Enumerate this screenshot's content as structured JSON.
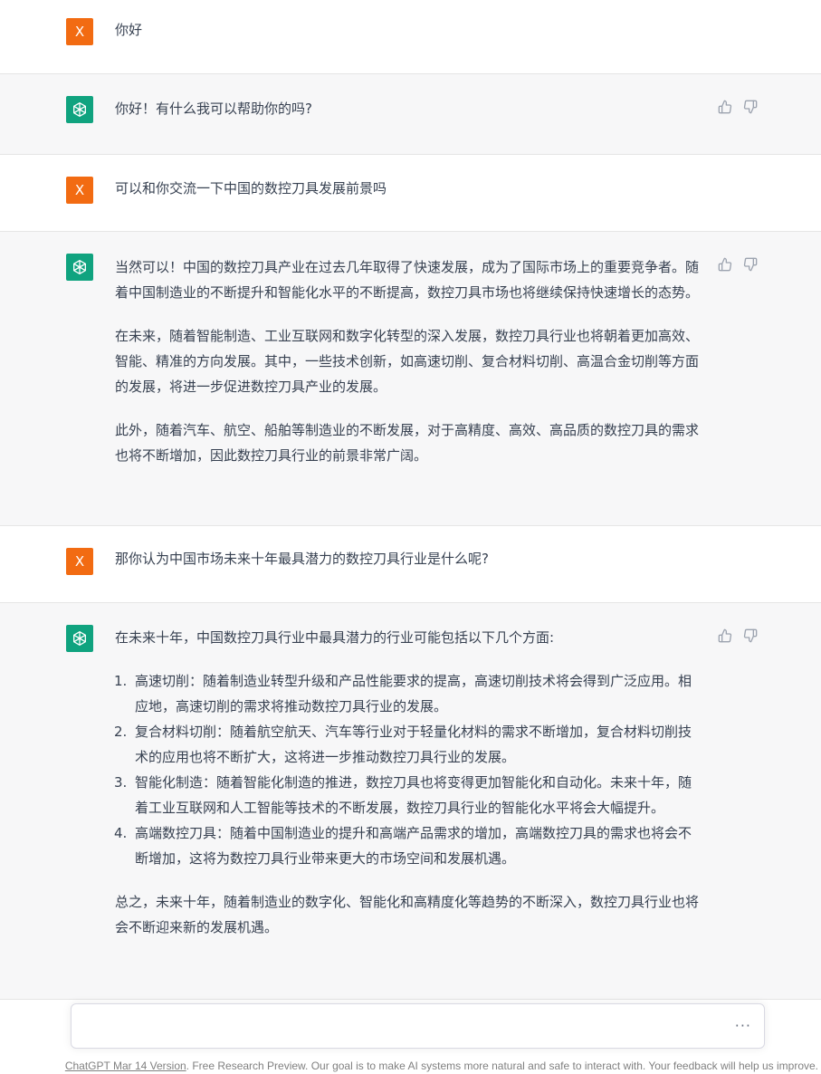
{
  "messages": [
    {
      "role": "user",
      "avatar_letter": "X",
      "text": "你好"
    },
    {
      "role": "assistant",
      "paragraphs": [
        "你好！有什么我可以帮助你的吗?"
      ]
    },
    {
      "role": "user",
      "avatar_letter": "X",
      "text": "可以和你交流一下中国的数控刀具发展前景吗"
    },
    {
      "role": "assistant",
      "paragraphs": [
        "当然可以！中国的数控刀具产业在过去几年取得了快速发展，成为了国际市场上的重要竞争者。随着中国制造业的不断提升和智能化水平的不断提高，数控刀具市场也将继续保持快速增长的态势。",
        "在未来，随着智能制造、工业互联网和数字化转型的深入发展，数控刀具行业也将朝着更加高效、智能、精准的方向发展。其中，一些技术创新，如高速切削、复合材料切削、高温合金切削等方面的发展，将进一步促进数控刀具产业的发展。",
        "此外，随着汽车、航空、船舶等制造业的不断发展，对于高精度、高效、高品质的数控刀具的需求也将不断增加，因此数控刀具行业的前景非常广阔。"
      ]
    },
    {
      "role": "user",
      "avatar_letter": "X",
      "text": "那你认为中国市场未来十年最具潜力的数控刀具行业是什么呢?"
    },
    {
      "role": "assistant",
      "intro": "在未来十年，中国数控刀具行业中最具潜力的行业可能包括以下几个方面:",
      "list": [
        {
          "num": "1.",
          "text": "高速切削：随着制造业转型升级和产品性能要求的提高，高速切削技术将会得到广泛应用。相应地，高速切削的需求将推动数控刀具行业的发展。"
        },
        {
          "num": "2.",
          "text": "复合材料切削：随着航空航天、汽车等行业对于轻量化材料的需求不断增加，复合材料切削技术的应用也将不断扩大，这将进一步推动数控刀具行业的发展。"
        },
        {
          "num": "3.",
          "text": "智能化制造：随着智能化制造的推进，数控刀具也将变得更加智能化和自动化。未来十年，随着工业互联网和人工智能等技术的不断发展，数控刀具行业的智能化水平将会大幅提升。"
        },
        {
          "num": "4.",
          "text": "高端数控刀具：随着中国制造业的提升和高端产品需求的增加，高端数控刀具的需求也将会不断增加，这将为数控刀具行业带来更大的市场空间和发展机遇。"
        }
      ],
      "outro": "总之，未来十年，随着制造业的数字化、智能化和高精度化等趋势的不断深入，数控刀具行业也将会不断迎来新的发展机遇。"
    }
  ],
  "icons": {
    "assistant_avatar": "openai-logo-icon",
    "thumbs_up": "thumbs-up-icon",
    "thumbs_down": "thumbs-down-icon",
    "more": "more-dots-icon"
  },
  "composer": {
    "more_label": "···"
  },
  "footer": {
    "link_text": "ChatGPT Mar 14 Version",
    "rest_text": ". Free Research Preview. Our goal is to make AI systems more natural and safe to interact with. Your feedback will help us improve."
  },
  "colors": {
    "user_avatar": "#f26b12",
    "assistant_avatar": "#10a37f",
    "assistant_bg": "#f7f7f8"
  }
}
